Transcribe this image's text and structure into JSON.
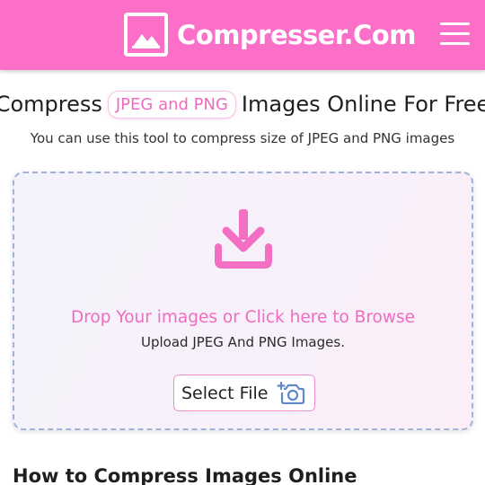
{
  "header": {
    "logo_text": "Compresser.Com",
    "logo_icon": "image-icon",
    "menu_icon": "hamburger-menu-icon",
    "background": "#fb6fc8"
  },
  "hero": {
    "title_prefix": "Compress",
    "title_pill": "JPEG and PNG",
    "title_suffix": "Images Online For Free",
    "subtitle": "You can use this tool to compress size of JPEG and PNG images"
  },
  "dropzone": {
    "icon": "download-icon",
    "drop_text": "Drop Your images or Click here to Browse",
    "upload_text": "Upload JPEG And PNG Images.",
    "select_button_label": "Select File",
    "select_button_icon": "add-photo-camera-icon",
    "accent": "#f06bc0"
  },
  "section": {
    "heading": "How to Compress Images Online"
  }
}
